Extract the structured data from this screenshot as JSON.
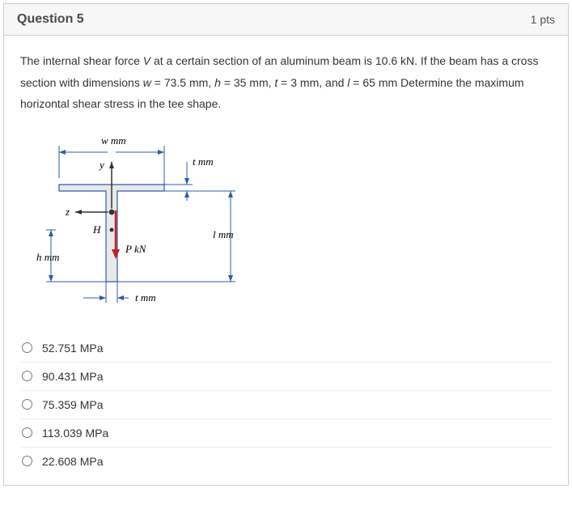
{
  "header": {
    "title": "Question 5",
    "points": "1 pts"
  },
  "question": {
    "text_html": "The internal shear force <i>V</i> at a certain section of an aluminum beam is 10.6 kN. If the beam has a cross section with dimensions <i>w</i> = 73.5 mm, <i>h</i> = 35 mm, <i>t</i> = 3 mm, and <i>l</i> = 65 mm Determine the maximum horizontal shear stress in the tee shape."
  },
  "figure": {
    "labels": {
      "w": "w mm",
      "y": "y",
      "t_top": "t mm",
      "z": "z",
      "H": "H",
      "l": "l mm",
      "P": "P kN",
      "h": "h mm",
      "t_bottom": "t mm"
    }
  },
  "options": [
    {
      "label": "52.751 MPa"
    },
    {
      "label": "90.431 MPa"
    },
    {
      "label": "75.359 MPa"
    },
    {
      "label": "113.039 MPa"
    },
    {
      "label": "22.608 MPa"
    }
  ]
}
